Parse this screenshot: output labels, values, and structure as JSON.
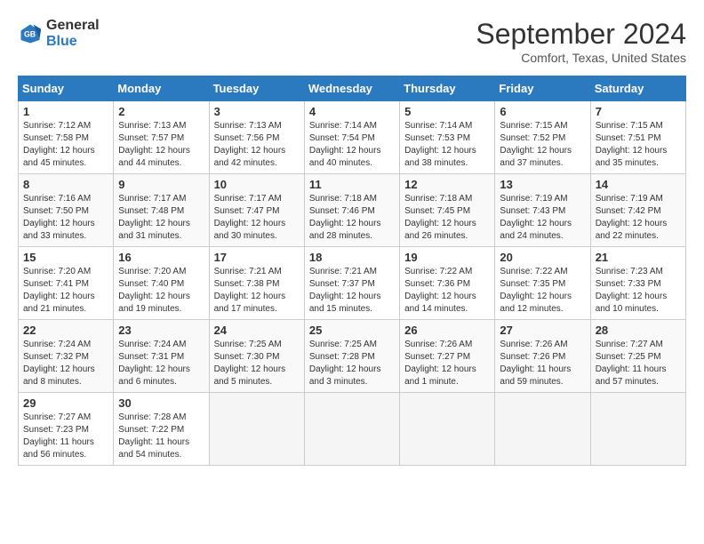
{
  "logo": {
    "general": "General",
    "blue": "Blue"
  },
  "title": "September 2024",
  "location": "Comfort, Texas, United States",
  "days_of_week": [
    "Sunday",
    "Monday",
    "Tuesday",
    "Wednesday",
    "Thursday",
    "Friday",
    "Saturday"
  ],
  "weeks": [
    [
      {
        "day": "1",
        "sunrise": "7:12 AM",
        "sunset": "7:58 PM",
        "daylight": "12 hours and 45 minutes."
      },
      {
        "day": "2",
        "sunrise": "7:13 AM",
        "sunset": "7:57 PM",
        "daylight": "12 hours and 44 minutes."
      },
      {
        "day": "3",
        "sunrise": "7:13 AM",
        "sunset": "7:56 PM",
        "daylight": "12 hours and 42 minutes."
      },
      {
        "day": "4",
        "sunrise": "7:14 AM",
        "sunset": "7:54 PM",
        "daylight": "12 hours and 40 minutes."
      },
      {
        "day": "5",
        "sunrise": "7:14 AM",
        "sunset": "7:53 PM",
        "daylight": "12 hours and 38 minutes."
      },
      {
        "day": "6",
        "sunrise": "7:15 AM",
        "sunset": "7:52 PM",
        "daylight": "12 hours and 37 minutes."
      },
      {
        "day": "7",
        "sunrise": "7:15 AM",
        "sunset": "7:51 PM",
        "daylight": "12 hours and 35 minutes."
      }
    ],
    [
      {
        "day": "8",
        "sunrise": "7:16 AM",
        "sunset": "7:50 PM",
        "daylight": "12 hours and 33 minutes."
      },
      {
        "day": "9",
        "sunrise": "7:17 AM",
        "sunset": "7:48 PM",
        "daylight": "12 hours and 31 minutes."
      },
      {
        "day": "10",
        "sunrise": "7:17 AM",
        "sunset": "7:47 PM",
        "daylight": "12 hours and 30 minutes."
      },
      {
        "day": "11",
        "sunrise": "7:18 AM",
        "sunset": "7:46 PM",
        "daylight": "12 hours and 28 minutes."
      },
      {
        "day": "12",
        "sunrise": "7:18 AM",
        "sunset": "7:45 PM",
        "daylight": "12 hours and 26 minutes."
      },
      {
        "day": "13",
        "sunrise": "7:19 AM",
        "sunset": "7:43 PM",
        "daylight": "12 hours and 24 minutes."
      },
      {
        "day": "14",
        "sunrise": "7:19 AM",
        "sunset": "7:42 PM",
        "daylight": "12 hours and 22 minutes."
      }
    ],
    [
      {
        "day": "15",
        "sunrise": "7:20 AM",
        "sunset": "7:41 PM",
        "daylight": "12 hours and 21 minutes."
      },
      {
        "day": "16",
        "sunrise": "7:20 AM",
        "sunset": "7:40 PM",
        "daylight": "12 hours and 19 minutes."
      },
      {
        "day": "17",
        "sunrise": "7:21 AM",
        "sunset": "7:38 PM",
        "daylight": "12 hours and 17 minutes."
      },
      {
        "day": "18",
        "sunrise": "7:21 AM",
        "sunset": "7:37 PM",
        "daylight": "12 hours and 15 minutes."
      },
      {
        "day": "19",
        "sunrise": "7:22 AM",
        "sunset": "7:36 PM",
        "daylight": "12 hours and 14 minutes."
      },
      {
        "day": "20",
        "sunrise": "7:22 AM",
        "sunset": "7:35 PM",
        "daylight": "12 hours and 12 minutes."
      },
      {
        "day": "21",
        "sunrise": "7:23 AM",
        "sunset": "7:33 PM",
        "daylight": "12 hours and 10 minutes."
      }
    ],
    [
      {
        "day": "22",
        "sunrise": "7:24 AM",
        "sunset": "7:32 PM",
        "daylight": "12 hours and 8 minutes."
      },
      {
        "day": "23",
        "sunrise": "7:24 AM",
        "sunset": "7:31 PM",
        "daylight": "12 hours and 6 minutes."
      },
      {
        "day": "24",
        "sunrise": "7:25 AM",
        "sunset": "7:30 PM",
        "daylight": "12 hours and 5 minutes."
      },
      {
        "day": "25",
        "sunrise": "7:25 AM",
        "sunset": "7:28 PM",
        "daylight": "12 hours and 3 minutes."
      },
      {
        "day": "26",
        "sunrise": "7:26 AM",
        "sunset": "7:27 PM",
        "daylight": "12 hours and 1 minute."
      },
      {
        "day": "27",
        "sunrise": "7:26 AM",
        "sunset": "7:26 PM",
        "daylight": "11 hours and 59 minutes."
      },
      {
        "day": "28",
        "sunrise": "7:27 AM",
        "sunset": "7:25 PM",
        "daylight": "11 hours and 57 minutes."
      }
    ],
    [
      {
        "day": "29",
        "sunrise": "7:27 AM",
        "sunset": "7:23 PM",
        "daylight": "11 hours and 56 minutes."
      },
      {
        "day": "30",
        "sunrise": "7:28 AM",
        "sunset": "7:22 PM",
        "daylight": "11 hours and 54 minutes."
      },
      null,
      null,
      null,
      null,
      null
    ]
  ],
  "labels": {
    "sunrise": "Sunrise:",
    "sunset": "Sunset:",
    "daylight": "Daylight:"
  }
}
